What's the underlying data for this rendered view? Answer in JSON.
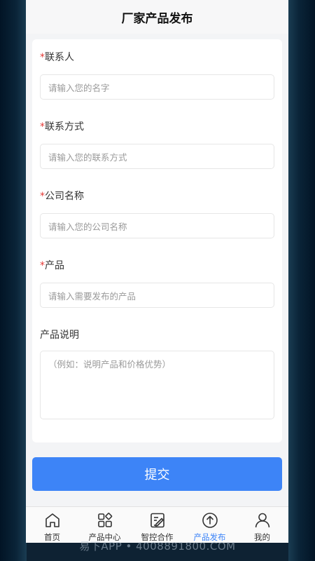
{
  "header": {
    "title": "厂家产品发布"
  },
  "form": {
    "contact": {
      "required_mark": "*",
      "label": "联系人",
      "placeholder": "请输入您的名字"
    },
    "phone": {
      "required_mark": "*",
      "label": "联系方式",
      "placeholder": "请输入您的联系方式"
    },
    "company": {
      "required_mark": "*",
      "label": "公司名称",
      "placeholder": "请输入您的公司名称"
    },
    "product": {
      "required_mark": "*",
      "label": "产品",
      "placeholder": "请输入需要发布的产品"
    },
    "description": {
      "label": "产品说明",
      "placeholder": "（例如：说明产品和价格优势）"
    }
  },
  "submit_label": "提交",
  "tabbar": {
    "items": [
      {
        "label": "首页",
        "icon": "home-icon"
      },
      {
        "label": "产品中心",
        "icon": "grid-icon"
      },
      {
        "label": "智控合作",
        "icon": "edit-doc-icon"
      },
      {
        "label": "产品发布",
        "icon": "upload-circle-icon",
        "active": true
      },
      {
        "label": "我的",
        "icon": "user-icon"
      }
    ]
  },
  "watermark": "易下APP • 4008891800.COM",
  "colors": {
    "accent": "#3d84f7",
    "required": "#e53935"
  }
}
